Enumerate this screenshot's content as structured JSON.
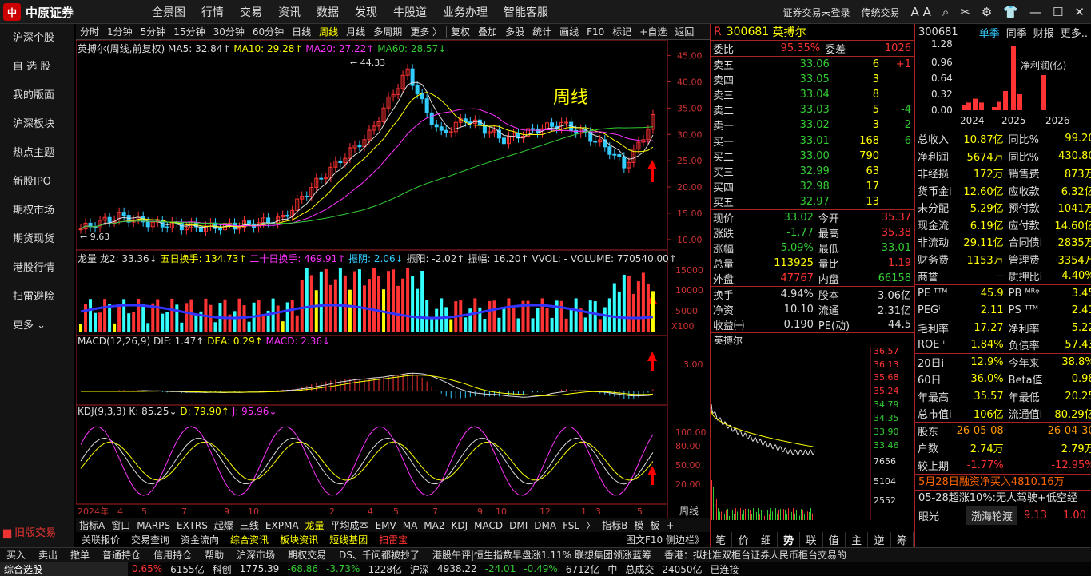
{
  "header": {
    "logo_text": "中原证券",
    "menu": [
      "全景图",
      "行情",
      "交易",
      "资讯",
      "数据",
      "发现",
      "牛股道",
      "业务办理",
      "智能客服"
    ],
    "login": "证券交易未登录",
    "style": "传统交易"
  },
  "sidebar": {
    "items": [
      "沪深个股",
      "自 选 股",
      "我的版面",
      "沪深板块",
      "热点主题",
      "新股IPO",
      "期权市场",
      "期货现货",
      "港股行情",
      "扫雷避险",
      "更多"
    ],
    "old": "旧版交易"
  },
  "toolbar": {
    "periods": [
      "分时",
      "1分钟",
      "5分钟",
      "15分钟",
      "30分钟",
      "60分钟",
      "日线",
      "周线",
      "月线",
      "多周期",
      "更多 〉"
    ],
    "active": "周线",
    "tools": [
      "复权",
      "叠加",
      "多股",
      "统计",
      "画线",
      "F10",
      "标记",
      "+自选",
      "返回"
    ]
  },
  "main_chart": {
    "title": "英搏尔(周线,前复权)",
    "ma5": "MA5: 32.84↑",
    "ma10": "MA10: 29.28↑",
    "ma20": "MA20: 27.22↑",
    "ma60": "MA60: 28.57↓",
    "high_label": "44.33",
    "low_label": "9.63",
    "annotation": "周线",
    "axis": [
      "45.00",
      "40.00",
      "35.00",
      "30.00",
      "25.00",
      "20.00",
      "15.00",
      "10.00"
    ]
  },
  "vol_chart": {
    "title": "龙量",
    "v1": "龙2: 33.36↓",
    "v2": "五日换手: 134.73↑",
    "v3": "二十日换手: 469.91↑",
    "v4": "振阴: 2.06↓",
    "v5": "振阳: -2.02↑",
    "v6": "振幅: 16.20↑",
    "v7": "VVOL: -",
    "v8": "VOLUME: 770540.00↑",
    "axis": [
      "15000",
      "10000",
      "5000"
    ],
    "unit": "X100"
  },
  "macd_chart": {
    "title": "MACD(12,26,9)",
    "dif": "DIF: 1.47↑",
    "dea": "DEA: 0.29↑",
    "macd": "MACD: 2.36↓",
    "axis": [
      "3.00"
    ]
  },
  "kdj_chart": {
    "title": "KDJ(9,3,3)",
    "k": "K: 85.25↓",
    "d": "D: 79.90↑",
    "j": "J: 95.96↓",
    "axis": [
      "100.00",
      "80.00",
      "50.00",
      "20.00"
    ]
  },
  "xaxis": {
    "labels": [
      "2024年",
      "4",
      "5",
      "7",
      "9",
      "10",
      "2",
      "4",
      "5",
      "7",
      "9",
      "10",
      "12",
      "1",
      "3",
      "5"
    ],
    "period": "周线"
  },
  "bottom_tabs": [
    "指标A",
    "窗口",
    "MARPS",
    "EXTRS",
    "起爆",
    "三线",
    "EXPMA",
    "龙量",
    "平均成本",
    "EMV",
    "MA",
    "MA2",
    "KDJ",
    "MACD",
    "DMI",
    "DMA",
    "FSL",
    "〉",
    "指标B",
    "模",
    "板",
    "+",
    "-"
  ],
  "bottom_tabs_active": "龙量",
  "bottom2": [
    "关联报价",
    "交易查询",
    "资金流向",
    "综合资讯",
    "板块资讯",
    "短线基因",
    "扫雷宝"
  ],
  "bottom2_right": "图文F10 侧边栏》",
  "quote": {
    "code": "300681",
    "name": "英搏尔",
    "weibi_label": "委比",
    "weibi": "95.35%",
    "weicha_label": "委差",
    "weicha": "1026",
    "sell": [
      [
        "卖五",
        "33.06",
        "6",
        "+1"
      ],
      [
        "卖四",
        "33.05",
        "3",
        ""
      ],
      [
        "卖三",
        "33.04",
        "8",
        ""
      ],
      [
        "卖二",
        "33.03",
        "5",
        "-4"
      ],
      [
        "卖一",
        "33.02",
        "3",
        "-2"
      ]
    ],
    "buy": [
      [
        "买一",
        "33.01",
        "168",
        "-6"
      ],
      [
        "买二",
        "33.00",
        "790",
        ""
      ],
      [
        "买三",
        "32.99",
        "63",
        ""
      ],
      [
        "买四",
        "32.98",
        "17",
        ""
      ],
      [
        "买五",
        "32.97",
        "13",
        ""
      ]
    ],
    "stats": [
      [
        "现价",
        "33.02",
        "今开",
        "35.37"
      ],
      [
        "涨跌",
        "-1.77",
        "最高",
        "35.38"
      ],
      [
        "涨幅",
        "-5.09%",
        "最低",
        "33.01"
      ],
      [
        "总量",
        "113925",
        "量比",
        "1.19"
      ],
      [
        "外盘",
        "47767",
        "内盘",
        "66158"
      ],
      [
        "换手",
        "4.94%",
        "股本",
        "3.06亿"
      ],
      [
        "净资",
        "10.10",
        "流通",
        "2.31亿"
      ],
      [
        "收益㈠",
        "0.190",
        "PE(动)",
        "44.5"
      ]
    ],
    "mini_title": "英搏尔",
    "mini_axis": [
      "36.57",
      "36.13",
      "35.68",
      "35.24",
      "34.79",
      "34.35",
      "33.90",
      "33.46",
      "7656",
      "5104",
      "2552"
    ],
    "tabs": [
      "笔",
      "价",
      "细",
      "势",
      "联",
      "值",
      "主",
      "逆",
      "筹"
    ]
  },
  "fin": {
    "code": "300681",
    "tabs": [
      "单季",
      "同季",
      "财报",
      "更多.."
    ],
    "chart_label": "净利润(亿)",
    "chart_axis": [
      "1.28",
      "0.96",
      "0.64",
      "0.32",
      "0.00"
    ],
    "years": [
      "2024",
      "2025",
      "2026"
    ],
    "rows": [
      [
        "总收入",
        "10.87亿",
        "同比%",
        "99.20"
      ],
      [
        "净利润",
        "5674万",
        "同比%",
        "430.80"
      ],
      [
        "非经损",
        "172万",
        "销售费",
        "873万"
      ],
      [
        "货币金i",
        "12.60亿",
        "应收款",
        "6.32亿"
      ],
      [
        "未分配",
        "5.29亿",
        "预付款",
        "1041万"
      ],
      [
        "现金流",
        "6.19亿",
        "应付款",
        "14.60亿"
      ],
      [
        "非流动",
        "29.11亿",
        "合同债i",
        "2835万"
      ],
      [
        "财务费",
        "1153万",
        "管理费",
        "3354万"
      ],
      [
        "商誉",
        "--",
        "质押比i",
        "4.40%"
      ],
      [
        "PE ᵀᵀᴹ",
        "45.9",
        "PB ᴹᴿᵠ",
        "3.45"
      ],
      [
        "PEGⁱ",
        "2.11",
        "PS ᵀᵀᴹ",
        "2.41"
      ],
      [
        "毛利率",
        "17.27",
        "净利率",
        "5.22"
      ],
      [
        "ROE ⁱ",
        "1.84%",
        "负债率",
        "57.43"
      ],
      [
        "20日i",
        "12.9%",
        "今年来",
        "38.8%"
      ],
      [
        "60日",
        "36.0%",
        "Beta值",
        "0.98"
      ],
      [
        "年最高",
        "35.57",
        "年最低",
        "20.25"
      ],
      [
        "总市值i",
        "106亿",
        "流通值i",
        "80.29亿"
      ],
      [
        "股东",
        "26-05-08",
        "",
        "26-04-30"
      ],
      [
        "户数",
        "2.74万",
        "",
        "2.79万"
      ],
      [
        "较上期",
        "-1.77%",
        "",
        "-12.95%"
      ]
    ],
    "news1": "5月28日融资净买入4810.16万",
    "news2": "05-28超涨10%:无人驾驶+低空经",
    "eyelight": "眼光",
    "ticker_name": "渤海轮渡",
    "ticker_price": "9.13",
    "ticker_chg": "1.00"
  },
  "tradebar": [
    "买入",
    "卖出",
    "撤单",
    "普通持仓",
    "信用持仓",
    "帮助",
    "沪深市场",
    "期权交易",
    "DS、千问都被抄了",
    "港股午评|恒生指数早盘涨1.11% 联想集团领涨蓝筹",
    "香港：拟批准双柜台证券人民币柜台交易的"
  ],
  "statusbar": {
    "left": "综合选股",
    "items": [
      "0.65%",
      "6155亿",
      "科创",
      "1775.39",
      "-68.86",
      "-3.73%",
      "1228亿",
      "沪深",
      "4938.22",
      "-24.01",
      "-0.49%",
      "6712亿",
      "中",
      "总成交",
      "24050亿",
      "已连接"
    ]
  },
  "chart_data": {
    "type": "candlestick",
    "period": "weekly",
    "ylim": [
      9.63,
      44.33
    ],
    "high": 44.33,
    "low": 9.63,
    "last_close": 33.02
  }
}
